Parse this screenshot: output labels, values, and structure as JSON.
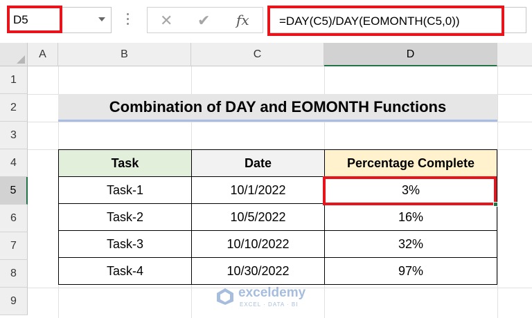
{
  "formula_bar": {
    "name_box": "D5",
    "cancel_icon": "✕",
    "enter_icon": "✔",
    "fx_label": "fx",
    "formula": "=DAY(C5)/DAY(EOMONTH(C5,0))"
  },
  "columns": [
    "A",
    "B",
    "C",
    "D"
  ],
  "rows": [
    "1",
    "2",
    "3",
    "4",
    "5",
    "6",
    "7",
    "8",
    "9"
  ],
  "selected_cell": "D5",
  "title": "Combination of DAY and EOMONTH Functions",
  "table": {
    "headers": {
      "task": "Task",
      "date": "Date",
      "pct": "Percentage Complete"
    },
    "rows": [
      {
        "task": "Task-1",
        "date": "10/1/2022",
        "pct": "3%"
      },
      {
        "task": "Task-2",
        "date": "10/5/2022",
        "pct": "16%"
      },
      {
        "task": "Task-3",
        "date": "10/10/2022",
        "pct": "32%"
      },
      {
        "task": "Task-4",
        "date": "10/30/2022",
        "pct": "97%"
      }
    ]
  },
  "watermark": {
    "name": "exceldemy",
    "sub": "EXCEL · DATA · BI"
  },
  "colors": {
    "highlight": "#e8141b",
    "selection": "#217346",
    "header_task": "#e2efda",
    "header_pct": "#fff2cc"
  }
}
